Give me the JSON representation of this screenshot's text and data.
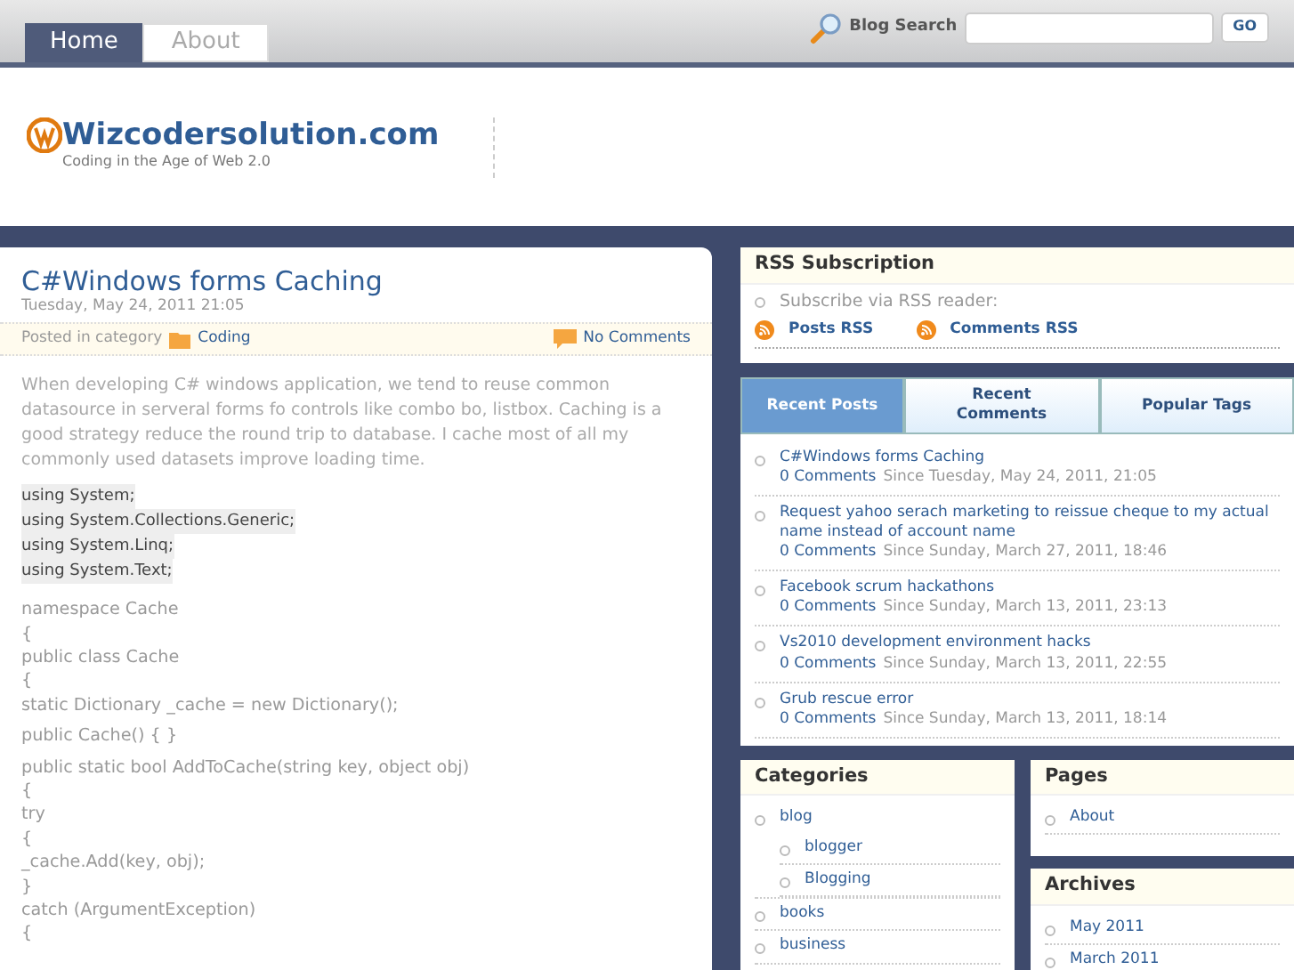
{
  "nav": {
    "tabs": [
      {
        "label": "Home",
        "selected": true
      },
      {
        "label": "About",
        "selected": false
      }
    ]
  },
  "search": {
    "label": "Blog Search",
    "button": "GO"
  },
  "header": {
    "site_title": "Wizcodersolution.com",
    "tagline": "Coding in the Age of Web 2.0"
  },
  "post": {
    "title": "C#Windows forms Caching",
    "date": "Tuesday, May 24, 2011 21:05",
    "category_label": "Posted in category",
    "category": "Coding",
    "comments": "No Comments",
    "intro": "When developing C# windows application, we tend to reuse common datasource in serveral forms fo controls like combo bo, listbox. Caching is a good strategy reduce the round trip to database. I cache most of all my commonly used datasets improve loading time.",
    "using_lines": [
      "using System;",
      "using System.Collections.Generic;",
      "using System.Linq;",
      "using System.Text;"
    ],
    "code_blocks": [
      [
        "namespace Cache",
        "{",
        "public class Cache",
        "{",
        "static Dictionary _cache = new Dictionary();"
      ],
      [
        "public Cache() { }"
      ],
      [
        "public static bool AddToCache(string key, object obj)",
        "{",
        "try",
        "{",
        "_cache.Add(key, obj);",
        "}",
        "catch (ArgumentException)",
        "{"
      ]
    ]
  },
  "rss": {
    "title": "RSS Subscription",
    "subscribe": "Subscribe via RSS reader:",
    "links": [
      "Posts RSS",
      "Comments RSS"
    ]
  },
  "sidebar_tabs": [
    {
      "label": "Recent Posts",
      "selected": true
    },
    {
      "label": "Recent Comments",
      "selected": false
    },
    {
      "label": "Popular Tags",
      "selected": false
    }
  ],
  "recent_posts": [
    {
      "title": "C#Windows forms Caching",
      "comments": "0 Comments",
      "since": "Since Tuesday, May 24, 2011, 21:05"
    },
    {
      "title": "Request yahoo serach marketing to reissue cheque to my actual name instead of account name",
      "comments": "0 Comments",
      "since": "Since Sunday, March 27, 2011, 18:46"
    },
    {
      "title": "Facebook scrum hackathons",
      "comments": "0 Comments",
      "since": "Since Sunday, March 13, 2011, 23:13"
    },
    {
      "title": "Vs2010 development environment hacks",
      "comments": "0 Comments",
      "since": "Since Sunday, March 13, 2011, 22:55"
    },
    {
      "title": "Grub rescue error",
      "comments": "0 Comments",
      "since": "Since Sunday, March 13, 2011, 18:14"
    }
  ],
  "categories": {
    "title": "Categories",
    "items": [
      {
        "label": "blog",
        "children": [
          {
            "label": "blogger"
          },
          {
            "label": "Blogging"
          }
        ]
      },
      {
        "label": "books"
      },
      {
        "label": "business"
      }
    ]
  },
  "pages": {
    "title": "Pages",
    "items": [
      "About"
    ]
  },
  "archives": {
    "title": "Archives",
    "items": [
      "May 2011",
      "March 2011"
    ]
  }
}
